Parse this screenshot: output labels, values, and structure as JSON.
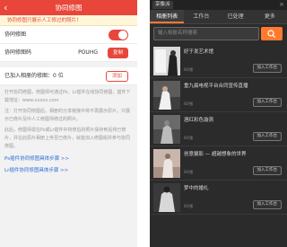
{
  "left": {
    "header": {
      "back": "‹",
      "title": "协同修图"
    },
    "notice": "协同修图只展示人工修过的照片！",
    "rows": {
      "collab": {
        "label": "协同修图"
      },
      "code": {
        "label": "协同修图码",
        "value": "POUHG",
        "action": "复制"
      },
      "joined": {
        "label": "已加入相册的修图：0 位",
        "action": "添加"
      }
    },
    "help": [
      "打开协同修图，修图师可通过Ps、Lr插件在线协同修图，插件下载地址：www.xxxxx.com",
      "注：打开协同修图后，相册的分享链接中将不再展示原片，只展示已修片及中人工修图师修过的照片。",
      "此后，修图师需在Ps或Lr插件中将修后的照片保存到后将已修片，并在此原片相册上传至已修片，就能加入修图组并参与协同修图。"
    ],
    "links": [
      "Ps插件协同修图具体步骤 >>",
      "Lr插件协同修图具体步骤 >>"
    ]
  },
  "right": {
    "app_title": "享像派",
    "close": "×",
    "tabs": [
      "相册列表",
      "工作台",
      "已处理",
      "更多"
    ],
    "search_placeholder": "输入相册名称搜索",
    "join_label": "加入工作台",
    "items": [
      {
        "name": "好于发艺术馆",
        "count": "60张"
      },
      {
        "name": "重九晨电视平台合同宣传直播",
        "count": "60张"
      },
      {
        "name": "酒红彩色漩涡",
        "count": "60张"
      },
      {
        "name": "创意摄影 — 超越想象的世界",
        "count": "60张"
      },
      {
        "name": "梦中的婚礼",
        "count": "60张"
      }
    ]
  }
}
